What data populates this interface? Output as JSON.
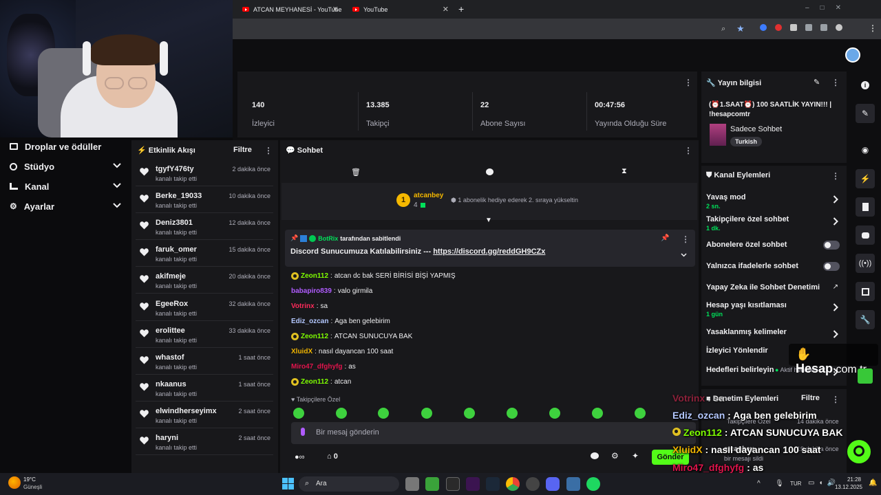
{
  "browser": {
    "tabs": [
      {
        "title": "ATCAN MEYHANESİ - YouTube"
      },
      {
        "title": "YouTube"
      }
    ],
    "new_tab": "+"
  },
  "left_nav": {
    "items": [
      {
        "label": "Droplar ve ödüller",
        "icon": "gift-icon"
      },
      {
        "label": "Stüdyo",
        "icon": "studio-icon"
      },
      {
        "label": "Kanal",
        "icon": "channel-icon"
      },
      {
        "label": "Ayarlar",
        "icon": "gear-icon"
      }
    ]
  },
  "stats": [
    {
      "value": "140",
      "label": "İzleyici"
    },
    {
      "value": "13.385",
      "label": "Takipçi"
    },
    {
      "value": "22",
      "label": "Abone Sayısı"
    },
    {
      "value": "00:47:56",
      "label": "Yayında Olduğu Süre"
    }
  ],
  "activity_feed": {
    "title": "Etkinlik Akışı",
    "filter": "Filtre",
    "items": [
      {
        "name": "tgyfY476ty",
        "action": "kanalı takip etti",
        "time": "2 dakika önce"
      },
      {
        "name": "Berke_19033",
        "action": "kanalı takip etti",
        "time": "10 dakika önce"
      },
      {
        "name": "Deniz3801",
        "action": "kanalı takip etti",
        "time": "12 dakika önce"
      },
      {
        "name": "faruk_omer",
        "action": "kanalı takip etti",
        "time": "15 dakika önce"
      },
      {
        "name": "akifmeje",
        "action": "kanalı takip etti",
        "time": "20 dakika önce"
      },
      {
        "name": "EgeeRox",
        "action": "kanalı takip etti",
        "time": "32 dakika önce"
      },
      {
        "name": "erolittee",
        "action": "kanalı takip etti",
        "time": "33 dakika önce"
      },
      {
        "name": "whastof",
        "action": "kanalı takip etti",
        "time": "1 saat önce"
      },
      {
        "name": "nkaanus",
        "action": "kanalı takip etti",
        "time": "1 saat önce"
      },
      {
        "name": "elwindherseyimx",
        "action": "kanalı takip etti",
        "time": "2 saat önce"
      },
      {
        "name": "haryni",
        "action": "kanalı takip etti",
        "time": "2 saat önce"
      }
    ]
  },
  "chat": {
    "title": "Sohbet",
    "leaderboard": {
      "rank": "1",
      "name": "atcanbey",
      "count": "4",
      "text": "1 abonelik hediye ederek 2. sıraya yükseltin"
    },
    "pinned": {
      "by_name": "BotRix",
      "by_suffix": "tarafından sabitlendi",
      "text": "Discord Sunucumuza Katılabilirsiniz ---",
      "link": "https://discord.gg/reddGH9CZx"
    },
    "messages": [
      {
        "user": "Zeon112",
        "color": "#7fff00",
        "text": "atcan dc bak SERİ BİRİSİ BİŞİ YAPMIŞ",
        "badge": true
      },
      {
        "user": "babapiro839",
        "color": "#b05cff",
        "text": "valo girmila",
        "badge": false
      },
      {
        "user": "Votrinx",
        "color": "#ff2a5a",
        "text": "sa",
        "badge": false
      },
      {
        "user": "Ediz_ozcan",
        "color": "#b4c8ff",
        "text": "Aga ben gelebirim",
        "badge": false
      },
      {
        "user": "Zeon112",
        "color": "#7fff00",
        "text": "ATCAN SUNUCUYA BAK",
        "badge": true
      },
      {
        "user": "XluidX",
        "color": "#f0b400",
        "text": "nasıl dayancan 100 saat",
        "badge": false
      },
      {
        "user": "Miro47_dfghyfg",
        "color": "#e0144c",
        "text": "as",
        "badge": false
      },
      {
        "user": "Zeon112",
        "color": "#7fff00",
        "text": "atcan",
        "badge": true
      }
    ],
    "followers_only": "Takipçilere Özel",
    "input_placeholder": "Bir mesaj gönderin",
    "points": "0",
    "send": "Gönder"
  },
  "stream_info": {
    "title": "Yayın bilgisi",
    "stream_title": "(⏰1.SAAT⏰) 100 SAATLİK YAYIN!!! | !hesapcomtr",
    "category": "Sadece Sohbet",
    "tag": "Turkish"
  },
  "channel_actions": {
    "title": "Kanal Eylemleri",
    "items": [
      {
        "label": "Yavaş mod",
        "sub": "2 sn.",
        "kind": "chevron"
      },
      {
        "label": "Takipçilere özel sohbet",
        "sub": "1 dk.",
        "kind": "chevron"
      },
      {
        "label": "Abonelere özel sohbet",
        "sub": "",
        "kind": "toggle"
      },
      {
        "label": "Yalnızca ifadelerle sohbet",
        "sub": "",
        "kind": "toggle"
      },
      {
        "label": "Yapay Zeka ile Sohbet Denetimi",
        "sub": "",
        "kind": "external"
      },
      {
        "label": "Hesap yaşı kısıtlaması",
        "sub": "1 gün",
        "kind": "chevron"
      },
      {
        "label": "Yasaklanmış kelimeler",
        "sub": "",
        "kind": "chevron"
      },
      {
        "label": "İzleyici Yönlendir",
        "sub": "",
        "kind": "none"
      },
      {
        "label": "Hedefleri belirleyin",
        "sub": "",
        "kind": "chevron"
      }
    ],
    "goals_status": "Aktif hedefler - 2"
  },
  "mod_actions": {
    "title": "Denetim Eylemleri",
    "filter": "Filtre",
    "time1": "14 dakika önce",
    "time2": "19 dakika önce",
    "user": "atcanbey",
    "deleted": "bir mesajı sildi",
    "partial": "Takipçilere Özel"
  },
  "watermark": {
    "brand": "Hesap",
    "domain": ".com.tr"
  },
  "overlay_chat": [
    {
      "user": "Votrinx",
      "text": "sa"
    },
    {
      "user": "Ediz_ozcan",
      "text": "Aga ben gelebirim"
    },
    {
      "user": "Zeon112",
      "text": "ATCAN SUNUCUYA BAK"
    },
    {
      "user": "XluidX",
      "text": "nasıl dayancan 100 saat"
    },
    {
      "user": "Miro47_dfghyfg",
      "text": "as"
    },
    {
      "user": "Zeon112",
      "text": "atcan"
    }
  ],
  "taskbar": {
    "weather_temp": "19°C",
    "weather_desc": "Güneşli",
    "search": "Ara",
    "lang": "TUR",
    "time": "21:28",
    "date": "13.12.2025"
  }
}
